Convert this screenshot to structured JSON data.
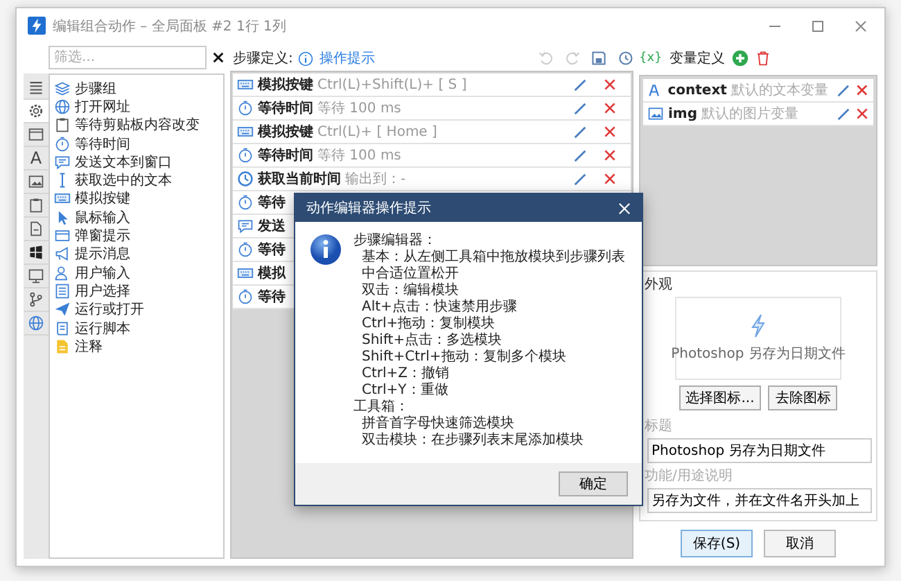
{
  "window": {
    "title": "编辑组合动作 – 全局面板 #2 1行 1列"
  },
  "toolbox": {
    "filter": {
      "placeholder": "筛选..."
    },
    "categories": [
      {
        "kind": "menu",
        "selected": false
      },
      {
        "kind": "gear",
        "selected": true
      },
      {
        "kind": "window",
        "selected": false
      },
      {
        "kind": "letter",
        "glyph": "A",
        "selected": false
      },
      {
        "kind": "image",
        "selected": false
      },
      {
        "kind": "clipboard",
        "selected": false
      },
      {
        "kind": "file",
        "selected": false
      },
      {
        "kind": "windows",
        "selected": false
      },
      {
        "kind": "monitor",
        "selected": false
      },
      {
        "kind": "branch",
        "selected": false
      },
      {
        "kind": "globe",
        "selected": false
      }
    ],
    "tools": [
      {
        "kind": "layers",
        "label": "步骤组"
      },
      {
        "kind": "globe",
        "label": "打开网址"
      },
      {
        "kind": "clipboard",
        "label": "等待剪贴板内容改变"
      },
      {
        "kind": "clock",
        "label": "等待时间"
      },
      {
        "kind": "chat",
        "label": "发送文本到窗口"
      },
      {
        "kind": "cursor",
        "label": "获取选中的文本"
      },
      {
        "kind": "keyboard",
        "label": "模拟按键"
      },
      {
        "kind": "pointer",
        "label": "鼠标输入"
      },
      {
        "kind": "popup",
        "label": "弹窗提示"
      },
      {
        "kind": "megaphone",
        "label": "提示消息"
      },
      {
        "kind": "user",
        "label": "用户输入"
      },
      {
        "kind": "list",
        "label": "用户选择"
      },
      {
        "kind": "send",
        "label": "运行或打开"
      },
      {
        "kind": "script",
        "label": "运行脚本"
      },
      {
        "kind": "note",
        "label": "注释"
      }
    ]
  },
  "steps": {
    "label": "步骤定义:",
    "help_link": "操作提示",
    "toolbar": [
      {
        "kind": "undo",
        "disabled": true
      },
      {
        "kind": "redo",
        "disabled": true
      },
      {
        "kind": "save",
        "disabled": false
      },
      {
        "kind": "history",
        "disabled": false
      }
    ],
    "rows": [
      {
        "kind": "keyboard",
        "name": "模拟按键",
        "detail": "Ctrl(L)+Shift(L)+ [ S ]"
      },
      {
        "kind": "clock",
        "name": "等待时间",
        "detail": "等待 100 ms"
      },
      {
        "kind": "keyboard",
        "name": "模拟按键",
        "detail": "Ctrl(L)+ [ Home ]"
      },
      {
        "kind": "clock",
        "name": "等待时间",
        "detail": "等待 100 ms"
      },
      {
        "kind": "time",
        "name": "获取当前时间",
        "detail": "输出到：-"
      },
      {
        "kind": "clock",
        "name": "等待"
      },
      {
        "kind": "chat",
        "name": "发送"
      },
      {
        "kind": "clock",
        "name": "等待"
      },
      {
        "kind": "keyboard",
        "name": "模拟"
      },
      {
        "kind": "clock",
        "name": "等待"
      }
    ]
  },
  "variables": {
    "icon_text": "{x}",
    "label": "变量定义",
    "items": [
      {
        "kind": "text",
        "name": "context",
        "description": "默认的文本变量"
      },
      {
        "kind": "image",
        "name": "img",
        "description": "默认的图片变量"
      }
    ]
  },
  "appearance": {
    "label": "外观",
    "preview_caption": "Photoshop 另存为日期文件",
    "choose_icon": "选择图标...",
    "remove_icon": "去除图标",
    "title_label": "标题",
    "title_value": "Photoshop 另存为日期文件",
    "desc_label": "功能/用途说明",
    "desc_value": "另存为文件，并在文件名开头加上"
  },
  "buttons": [
    {
      "label": "保存(S)",
      "primary": true
    },
    {
      "label": "取消",
      "primary": false
    }
  ],
  "dialog": {
    "title": "动作编辑器操作提示",
    "sections": [
      {
        "heading": "步骤编辑器：",
        "items": [
          "基本：从左侧工具箱中拖放模块到步骤列表中合适位置松开",
          "双击：编辑模块",
          "Alt+点击：快速禁用步骤",
          "Ctrl+拖动：复制模块",
          "Shift+点击：多选模块",
          "Shift+Ctrl+拖动：复制多个模块",
          "Ctrl+Z：撤销",
          "Ctrl+Y：重做"
        ]
      },
      {
        "heading": "工具箱：",
        "items": [
          "拼音首字母快速筛选模块",
          "双击模块：在步骤列表末尾添加模块"
        ]
      }
    ],
    "button": "确定"
  }
}
